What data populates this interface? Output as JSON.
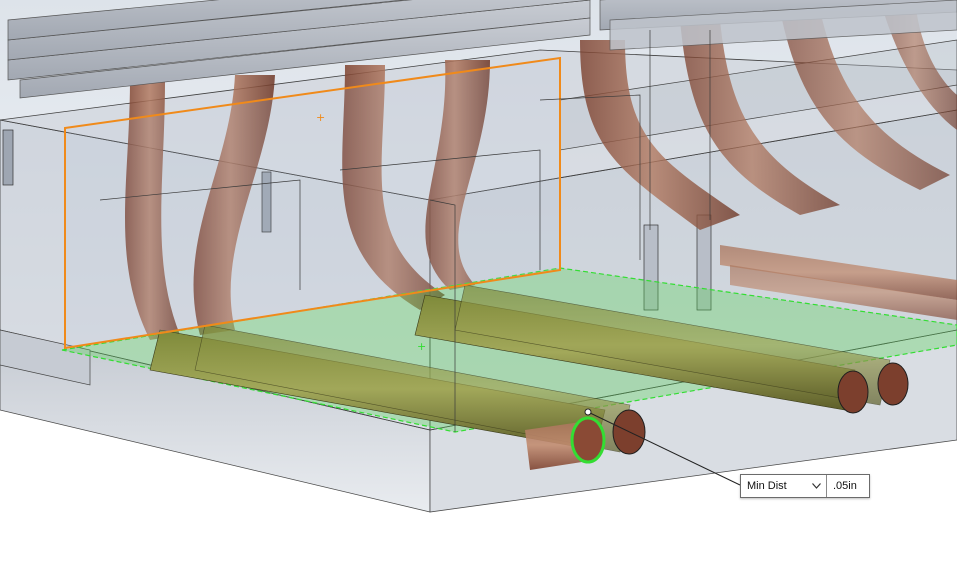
{
  "measurement": {
    "type_label": "Min Dist",
    "value": ".05in",
    "dropdown_icon": "chevron-down-icon"
  },
  "colors": {
    "pipe": "#8a4a35",
    "pipe_highlight": "#b07a5f",
    "selected_face": "#59d45a",
    "selected_edge_orange": "#f08a1a",
    "ghost_body": "#9aa3b2",
    "selected_circle": "#33dd33"
  }
}
